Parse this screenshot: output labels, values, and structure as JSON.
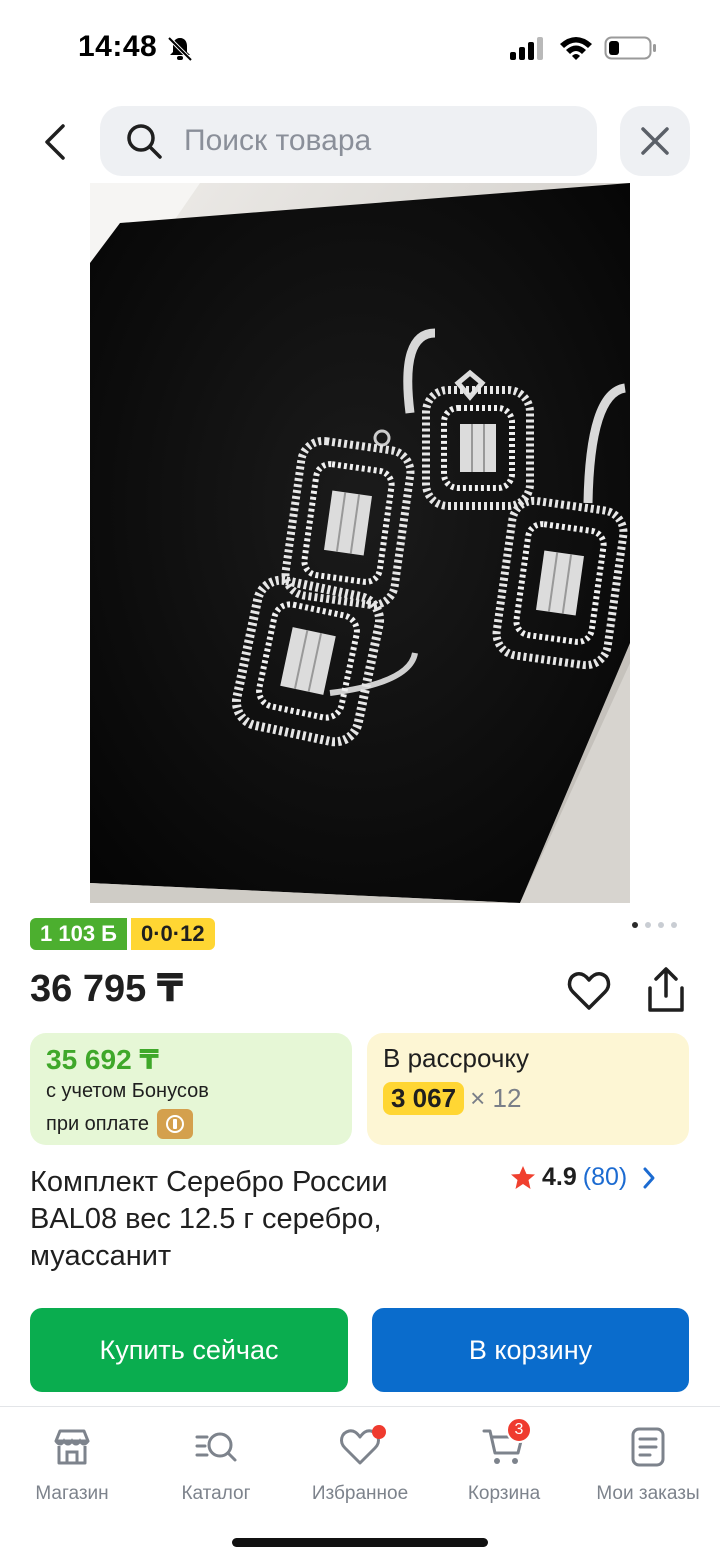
{
  "status_bar": {
    "time": "14:48"
  },
  "search": {
    "placeholder": "Поиск товара"
  },
  "badges": {
    "bonus": "1 103 Б",
    "installment": "0·0·12"
  },
  "product": {
    "price": "36 795 ₸",
    "title": "Комплект Серебро России BAL08 вес 12.5 г серебро, муассанит",
    "rating": "4.9",
    "reviews": "(80)",
    "image_count": 4,
    "active_image": 1
  },
  "bonus_card": {
    "price": "35 692 ₸",
    "note1": "с учетом Бонусов",
    "note2": "при оплате"
  },
  "install_card": {
    "title": "В рассрочку",
    "amount": "3 067",
    "times": "× 12"
  },
  "actions": {
    "buy": "Купить сейчас",
    "cart": "В корзину"
  },
  "tabs": [
    {
      "label": "Магазин",
      "icon": "store-icon"
    },
    {
      "label": "Каталог",
      "icon": "catalog-search-icon"
    },
    {
      "label": "Избранное",
      "icon": "heart-icon"
    },
    {
      "label": "Корзина",
      "icon": "cart-icon",
      "badge": "3"
    },
    {
      "label": "Мои заказы",
      "icon": "orders-icon"
    }
  ],
  "colors": {
    "buy": "#0aad4f",
    "cart": "#0a6ccc",
    "bonus_green": "#3fa82a",
    "installment_yellow": "#ffd633",
    "badge_red": "#ef3b2f"
  }
}
